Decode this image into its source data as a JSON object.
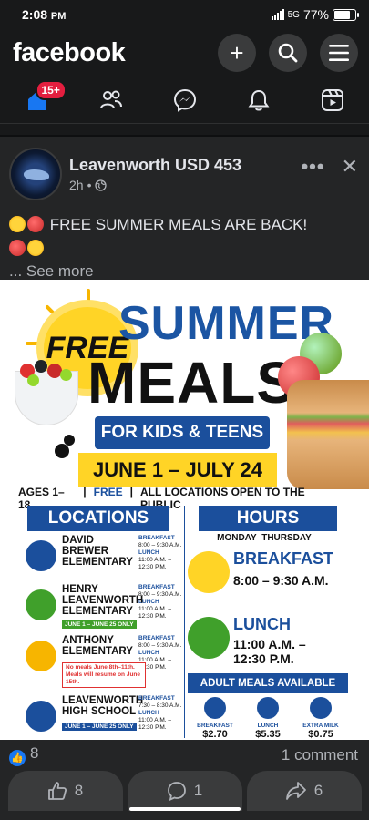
{
  "status": {
    "time": "2:08",
    "ampm": "PM",
    "network": "5G",
    "battery": "77%"
  },
  "header": {
    "logo": "facebook"
  },
  "tabs": {
    "home_badge": "15+"
  },
  "post": {
    "author": "Leavenworth USD 453",
    "time": "2h",
    "text": "FREE SUMMER MEALS ARE BACK!",
    "see_more": "... See more"
  },
  "flyer": {
    "free": "FREE",
    "summer": "SUMMER",
    "meals": "MEALS",
    "kids": "FOR KIDS & TEENS",
    "dates": "JUNE 1 – JULY 24",
    "ages": "AGES 1–18",
    "free_small": "FREE",
    "open": "ALL LOCATIONS OPEN TO THE PUBLIC",
    "locations_title": "LOCATIONS",
    "hours_title": "HOURS",
    "hours_days": "MONDAY–THURSDAY",
    "locations": [
      {
        "name": "DAVID BREWER ELEMENTARY",
        "b_label": "BREAKFAST",
        "b_time": "8:00 – 9:30 A.M.",
        "l_label": "LUNCH",
        "l_time": "11:00 A.M. – 12:30 P.M.",
        "tag": ""
      },
      {
        "name": "HENRY LEAVENWORTH ELEMENTARY",
        "b_label": "BREAKFAST",
        "b_time": "8:00 – 9:30 A.M.",
        "l_label": "LUNCH",
        "l_time": "11:00 A.M. – 12:30 P.M.",
        "tag": "JUNE 1 – JUNE 25 ONLY"
      },
      {
        "name": "ANTHONY ELEMENTARY",
        "b_label": "BREAKFAST",
        "b_time": "8:00 – 9:30 A.M.",
        "l_label": "LUNCH",
        "l_time": "11:00 A.M. – 12:30 P.M.",
        "tag": "No meals June 8th–11th. Meals will resume on June 15th."
      },
      {
        "name": "LEAVENWORTH HIGH SCHOOL",
        "b_label": "BREAKFAST",
        "b_time": "7:30 – 8:30 A.M.",
        "l_label": "LUNCH",
        "l_time": "11:00 A.M. – 12:30 P.M.",
        "tag": "JUNE 1 – JUNE 25 ONLY"
      }
    ],
    "breakfast_label": "BREAKFAST",
    "breakfast_time": "8:00 – 9:30 A.M.",
    "lunch_label": "LUNCH",
    "lunch_time_1": "11:00 A.M. –",
    "lunch_time_2": "12:30 P.M.",
    "adult_title": "ADULT MEALS AVAILABLE",
    "prices": [
      {
        "label": "BREAKFAST",
        "value": "$2.70"
      },
      {
        "label": "LUNCH",
        "value": "$5.35"
      },
      {
        "label": "EXTRA MILK",
        "value": "$0.75"
      }
    ]
  },
  "reactions": {
    "likes": "8",
    "comments": "1 comment"
  },
  "actions": {
    "like_count": "8",
    "comment_count": "1",
    "share_count": "6"
  },
  "colors": {
    "bg": "#242526",
    "brand_blue": "#1b4f9c",
    "yellow": "#ffd426",
    "fb_blue": "#1877f2",
    "badge_red": "#e41e3f"
  }
}
